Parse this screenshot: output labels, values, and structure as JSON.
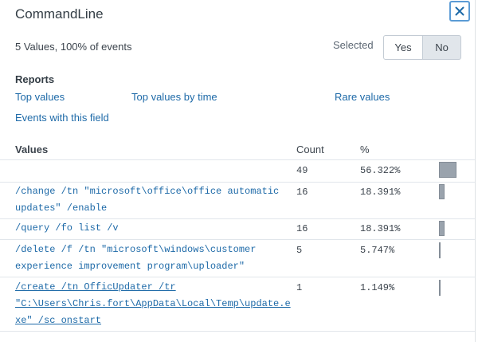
{
  "header": {
    "title": "CommandLine",
    "close_icon": "close-icon"
  },
  "summary": {
    "text": "5 Values, 100% of events",
    "selected_label": "Selected",
    "yes_label": "Yes",
    "no_label": "No",
    "selected_value": "No"
  },
  "reports": {
    "title": "Reports",
    "links": [
      "Top values",
      "Top values by time",
      "Rare values",
      "Events with this field"
    ]
  },
  "table": {
    "headers": {
      "values": "Values",
      "count": "Count",
      "percent": "%"
    },
    "rows": [
      {
        "value_lines": [],
        "count": "49",
        "percent": "56.322%",
        "fraction": 0.56322
      },
      {
        "value_lines": [
          "/change /tn \"microsoft\\office\\office automatic",
          "updates\" /enable"
        ],
        "count": "16",
        "percent": "18.391%",
        "fraction": 0.18391
      },
      {
        "value_lines": [
          "/query /fo list /v"
        ],
        "count": "16",
        "percent": "18.391%",
        "fraction": 0.18391
      },
      {
        "value_lines": [
          "/delete /f /tn \"microsoft\\windows\\customer",
          "experience improvement program\\uploader\""
        ],
        "count": "5",
        "percent": "5.747%",
        "fraction": 0.05747
      },
      {
        "value_lines": [
          "/create /tn OfficUpdater /tr",
          "\"C:\\Users\\Chris.fort\\AppData\\Local\\Temp\\update.e",
          "xe\" /sc onstart"
        ],
        "count": "1",
        "percent": "1.149%",
        "fraction": 0.01149
      }
    ]
  },
  "colors": {
    "link": "#1e6aa8",
    "bar": "#9aa3ad",
    "accent": "#5b9bd5"
  }
}
